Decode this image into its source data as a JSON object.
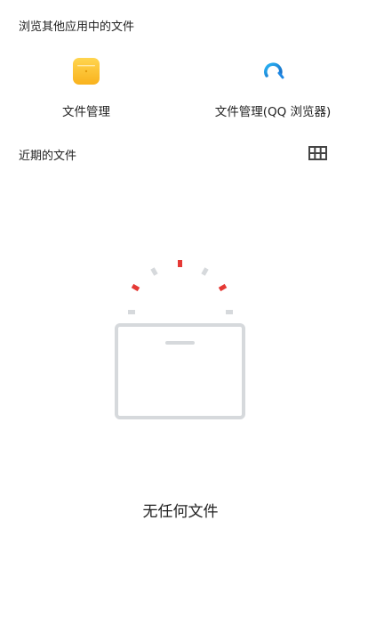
{
  "browse_section": {
    "title": "浏览其他应用中的文件"
  },
  "apps": [
    {
      "label": "文件管理",
      "icon": "folder-icon",
      "color": "#FBC02D"
    },
    {
      "label": "文件管理(QQ 浏览器)",
      "icon": "qq-browser-icon",
      "color": "#1E88E5"
    }
  ],
  "recent_section": {
    "title": "近期的文件",
    "view_toggle_icon": "grid-view-icon"
  },
  "empty_state": {
    "icon": "empty-box-icon",
    "message": "无任何文件"
  },
  "colors": {
    "accent_red": "#E53935",
    "box_gray": "#D6D9DC",
    "text": "#222222"
  }
}
